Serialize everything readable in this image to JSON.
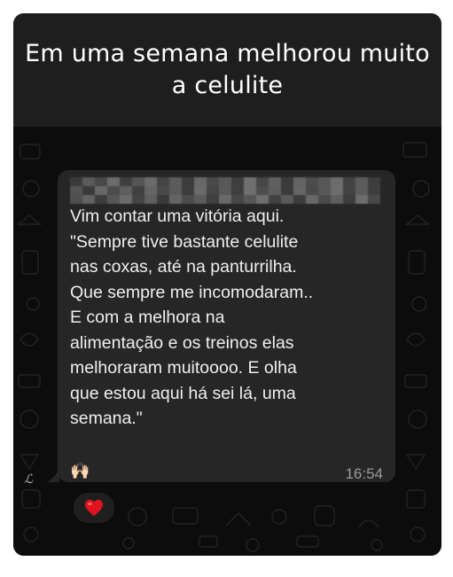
{
  "header": {
    "title": "Em uma semana melhorou muito a celulite"
  },
  "message": {
    "text": "Vim contar uma vitória aqui.\n\"Sempre tive bastante celulite\nnas coxas, até na panturrilha.\nQue sempre me incomodaram..\nE com a melhora na\nalimentação e os treinos elas\nmelhoraram muitoooo. E olha\nque estou aqui há sei lá, uma\nsemana.\"",
    "emoji": "🙌🏻",
    "time": "16:54"
  },
  "reaction": {
    "emoji": "❤️"
  },
  "colors": {
    "header_bg": "#1e1e1e",
    "chat_bg": "#0c0c0c",
    "bubble_bg": "#262626",
    "text": "#efefef",
    "time": "#9a9a9a"
  }
}
